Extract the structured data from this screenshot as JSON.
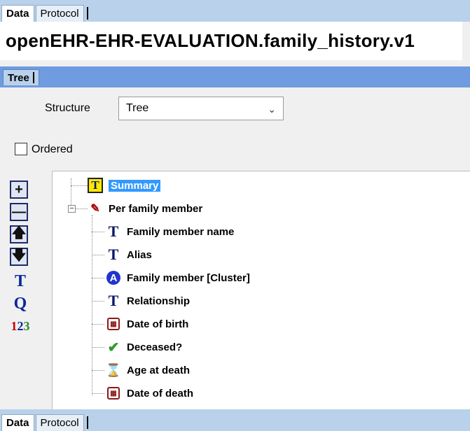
{
  "top_tabs": [
    {
      "label": "Data",
      "active": true
    },
    {
      "label": "Protocol",
      "active": false
    }
  ],
  "archetype_id": "openEHR-EHR-EVALUATION.family_history.v1",
  "tree_tab": {
    "label": "Tree"
  },
  "structure": {
    "label": "Structure",
    "value": "Tree"
  },
  "ordered": {
    "label": "Ordered",
    "checked": false
  },
  "toolbar": {
    "add_icon": "plus-icon",
    "remove_icon": "minus-icon",
    "up_icon": "arrow-up-icon",
    "down_icon": "arrow-down-icon",
    "text_icon": "T",
    "quantity_icon": "Q",
    "count_icon": "123"
  },
  "tree": {
    "summary": {
      "label": "Summary",
      "icon": "text-icon",
      "selected": true
    },
    "per_family_member": {
      "label": "Per family member",
      "icon": "cluster-icon"
    },
    "children": [
      {
        "label": "Family member name",
        "icon": "text-icon"
      },
      {
        "label": "Alias",
        "icon": "text-icon"
      },
      {
        "label": "Family member [Cluster]",
        "icon": "slot-icon"
      },
      {
        "label": "Relationship",
        "icon": "text-icon"
      },
      {
        "label": "Date of birth",
        "icon": "calendar-icon"
      },
      {
        "label": "Deceased?",
        "icon": "boolean-icon"
      },
      {
        "label": "Age at death",
        "icon": "hourglass-icon"
      },
      {
        "label": "Date of death",
        "icon": "calendar-icon"
      }
    ]
  },
  "colors": {
    "tab_strip": "#b9d1ea",
    "tree_bar": "#6f9be0",
    "selection": "#3399ff",
    "summary_icon_bg": "#ffe900"
  }
}
